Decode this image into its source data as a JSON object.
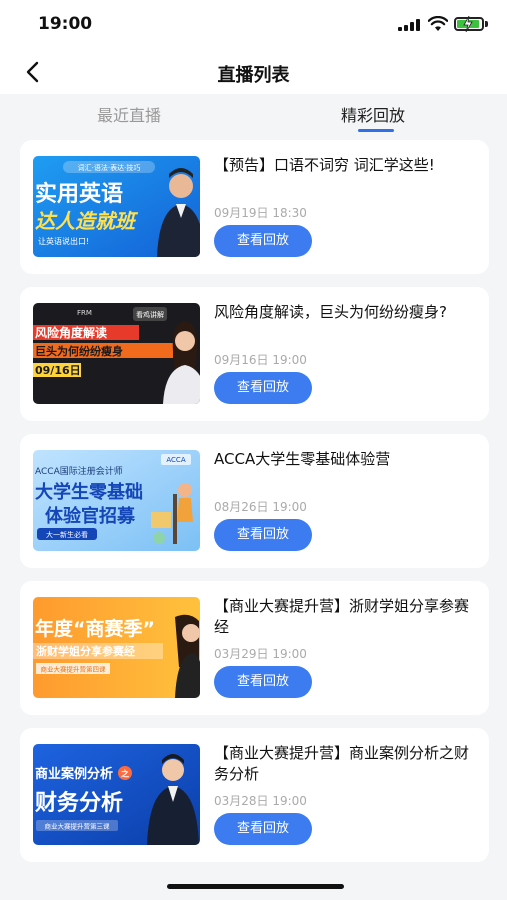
{
  "status": {
    "time": "19:00"
  },
  "nav": {
    "title": "直播列表"
  },
  "tabs": {
    "recent": "最近直播",
    "replay": "精彩回放"
  },
  "items": [
    {
      "title": "【预告】口语不词穷 词汇学这些!",
      "time": "09月19日 18:30",
      "button": "查看回放",
      "thumb": {
        "line1": "实用英语",
        "line2": "达人造就班",
        "tag": "词汇·语法·表达·技巧",
        "sub": "让英语说出口!"
      }
    },
    {
      "title": "风险角度解读，巨头为何纷纷瘦身?",
      "time": "09月16日 19:00",
      "button": "查看回放",
      "thumb": {
        "brand": "FRM",
        "line1": "风险角度解读",
        "line2": "巨头为何纷纷瘦身",
        "date": "09/16日",
        "badge": "看鸡讲解"
      }
    },
    {
      "title": "ACCA大学生零基础体验营",
      "time": "08月26日 19:00",
      "button": "查看回放",
      "thumb": {
        "top": "ACCA国际注册会计师",
        "line1": "大学生零基础",
        "line2": "体验官招募",
        "tag": "ACCA",
        "sub": "大一新生必看"
      }
    },
    {
      "title": "【商业大赛提升营】浙财学姐分享参赛经",
      "time": "03月29日 19:00",
      "button": "查看回放",
      "thumb": {
        "line1": "年度“商赛季”",
        "line2": "浙财学姐分享参赛经",
        "sub": "商业大赛提升营第四课"
      }
    },
    {
      "title": "【商业大赛提升营】商业案例分析之财务分析",
      "time": "03月28日 19:00",
      "button": "查看回放",
      "thumb": {
        "line1": "商业案例分析",
        "line2": "财务分析",
        "badge": "之",
        "sub": "商业大赛提升营第三课"
      }
    }
  ]
}
